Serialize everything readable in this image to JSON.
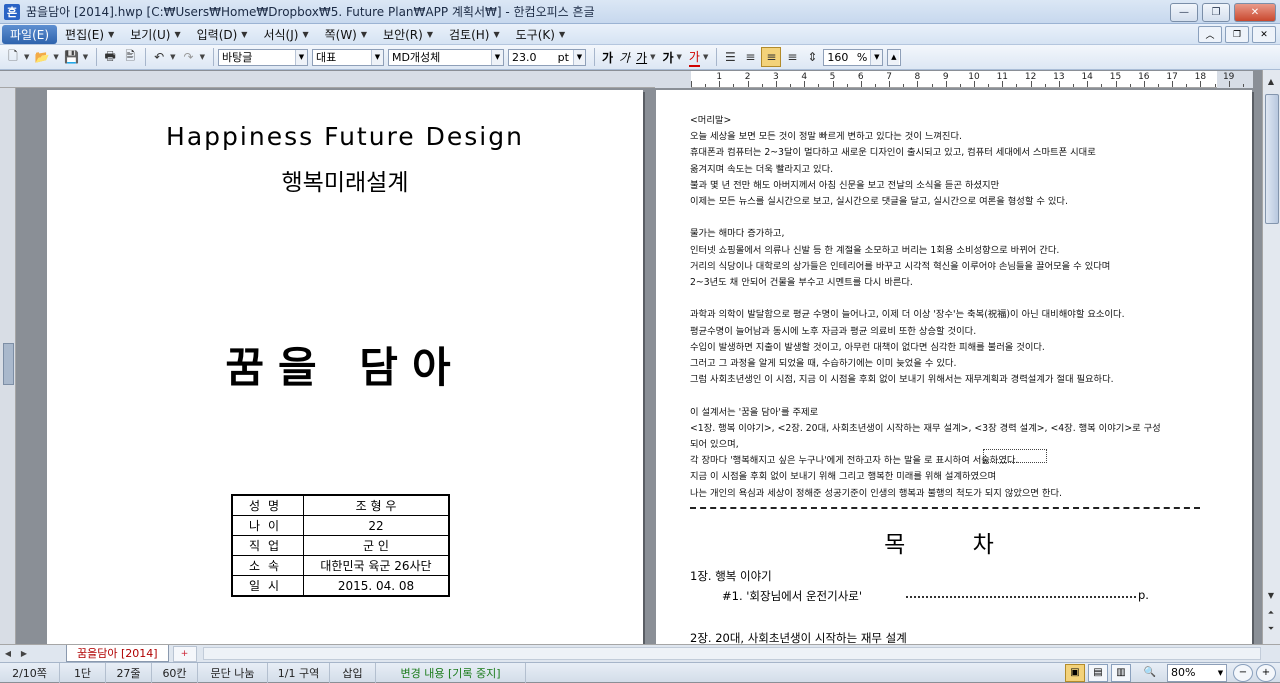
{
  "window": {
    "title": "꿈을담아 [2014].hwp [C:₩Users₩Home₩Dropbox₩5. Future Plan₩APP 계획서₩] - 한컴오피스 흔글",
    "app_icon": "흔"
  },
  "menu": [
    {
      "label": "파일(E)"
    },
    {
      "label": "편집(E)"
    },
    {
      "label": "보기(U)"
    },
    {
      "label": "입력(D)"
    },
    {
      "label": "서식(J)"
    },
    {
      "label": "쪽(W)"
    },
    {
      "label": "보안(R)"
    },
    {
      "label": "검토(H)"
    },
    {
      "label": "도구(K)"
    }
  ],
  "toolbar": {
    "style": "바탕글",
    "lang": "대표",
    "font": "MD개성체",
    "size": "23.0",
    "unit": "pt",
    "bold": "가",
    "italic": "가",
    "underline": "가",
    "strike": "가",
    "color": "가",
    "line_spacing": "160",
    "spacing_unit": "%"
  },
  "ruler": {
    "numbers": [
      "1",
      "2",
      "3",
      "4",
      "5",
      "6",
      "7",
      "8",
      "9",
      "10",
      "11",
      "12",
      "13",
      "14",
      "15",
      "16",
      "17",
      "18",
      "19"
    ]
  },
  "left_page": {
    "title_en": "Happiness Future Design",
    "title_ko": "행복미래설계",
    "big_title": "꿈을 담아",
    "info": [
      {
        "key": "성명",
        "value": "조 형 우"
      },
      {
        "key": "나이",
        "value": "22"
      },
      {
        "key": "직업",
        "value": "군 인"
      },
      {
        "key": "소속",
        "value": "대한민국 육군 26사단"
      },
      {
        "key": "일시",
        "value": "2015. 04. 08"
      }
    ]
  },
  "right_page": {
    "lines": [
      "<머리말>",
      "오늘 세상을 보면 모든 것이 정말 빠르게 변하고 있다는 것이 느껴진다.",
      "휴대폰과 컴퓨터는 2~3달이 멀다하고 새로운 디자인이 출시되고 있고, 컴퓨터 세대에서 스마트폰 시대로",
      "옮겨지며 속도는 더욱 빨라지고 있다.",
      "불과 몇 년 전만 해도 아버지께서 아침 신문을 보고 전날의 소식을 듣곤 하셨지만",
      "이제는 모든 뉴스를 실시간으로 보고, 실시간으로 댓글을 달고, 실시간으로 여론을 형성할 수 있다.",
      "",
      "물가는 해마다 증가하고,",
      "인터넷 쇼핑몰에서 의류나 신발 등 한 계절을 소모하고 버리는 1회용 소비성향으로 바뀌어 간다.",
      "거리의 식당이나 대학로의 상가들은 인테리어를 바꾸고 시각적 혁신을 이루어야 손님들을 끌어모을 수 있다며",
      "2~3년도 채 안되어 건물을 부수고 시멘트를 다시 바른다.",
      "",
      "과학과 의학이 발달함으로 평균 수명이 늘어나고, 이제 더 이상 '장수'는 축복(祝福)이 아닌 대비해야할 요소이다.",
      "평균수명이 늘어남과 동시에 노후 자금과 평균 의료비 또한 상승할 것이다.",
      "수입이 발생하면 지출이 발생할 것이고, 아무런 대책이 없다면 심각한 피해를 불러올 것이다.",
      "그러고 그 과정을 알게 되었을 때, 수습하기에는 이미 늦었을 수 있다.",
      "그럼 사회초년생인 이 시점, 지금 이 시점을 후회 없이 보내기 위해서는 재무계획과 경력설계가 절대 필요하다.",
      "",
      "이 설계서는 '꿈을 담아'를 주제로",
      "<1장. 행복 이야기>, <2장. 20대, 사회초년생이 시작하는 재무 설계>, <3장 경력 설계>, <4장. 행복 이야기>로 구성",
      "되어 있으며,",
      "각 장마다 '행복해지고 싶은 누구나'에게 전하고자 하는 말을                   로 표시하여 서술하였다.",
      "지금 이 시점을 후회 없이 보내기 위해 그리고 행복한 미래를 위해 설계하였으며",
      "나는 개인의 욕심과 세상이 정해준 성공기준이 인생의 행복과 불행의 척도가 되지 않았으면 한다."
    ],
    "toc_title": "목 차",
    "toc": [
      {
        "text": "1장. 행복 이야기"
      },
      {
        "text": "#1. '회장님에서 운전기사로'"
      },
      {
        "text": "p."
      },
      {
        "text": "2장. 20대, 사회초년생이 시작하는 재무 설계"
      }
    ]
  },
  "tabbar": {
    "doc_tab": "꿈을담아 [2014]",
    "new_tab": "+"
  },
  "status": {
    "page": "2/10쪽",
    "column": "1단",
    "line": "27줄",
    "char": "60칸",
    "mode": "문단 나눔",
    "section": "1/1 구역",
    "insert": "삽입",
    "track": "변경 내용 [기록 중지]",
    "zoom": "80%"
  },
  "colors": {
    "accent": "#2e63ad",
    "tab_text": "#b00000",
    "status_green": "#1c7c1c"
  }
}
